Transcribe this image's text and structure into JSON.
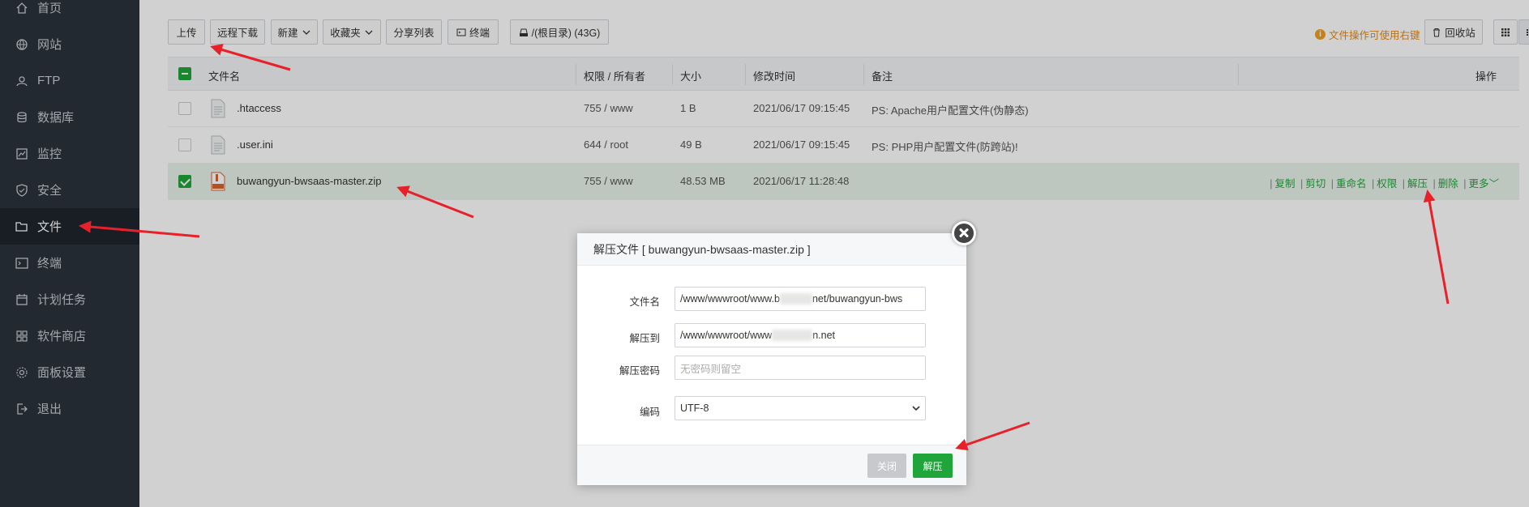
{
  "sidebar": {
    "items": [
      {
        "label": "首页",
        "icon": "home-icon"
      },
      {
        "label": "网站",
        "icon": "globe-icon"
      },
      {
        "label": "FTP",
        "icon": "ftp-icon"
      },
      {
        "label": "数据库",
        "icon": "database-icon"
      },
      {
        "label": "监控",
        "icon": "monitor-icon"
      },
      {
        "label": "安全",
        "icon": "shield-icon"
      },
      {
        "label": "文件",
        "icon": "folder-icon",
        "active": true
      },
      {
        "label": "终端",
        "icon": "terminal-icon"
      },
      {
        "label": "计划任务",
        "icon": "calendar-icon"
      },
      {
        "label": "软件商店",
        "icon": "apps-icon"
      },
      {
        "label": "面板设置",
        "icon": "gear-icon"
      },
      {
        "label": "退出",
        "icon": "logout-icon"
      }
    ]
  },
  "toolbar": {
    "upload": "上传",
    "remote_download": "远程下载",
    "new": "新建",
    "favorites": "收藏夹",
    "share_list": "分享列表",
    "terminal": "终端",
    "path": "/(根目录) (43G)",
    "tip": "文件操作可使用右键",
    "recycle": "回收站"
  },
  "table": {
    "headers": {
      "name": "文件名",
      "perm": "权限 / 所有者",
      "size": "大小",
      "mtime": "修改时间",
      "remark": "备注",
      "ops": "操作"
    },
    "rows": [
      {
        "name": ".htaccess",
        "perm": "755 / www",
        "size": "1 B",
        "mtime": "2021/06/17 09:15:45",
        "remark": "PS: Apache用户配置文件(伪静态)"
      },
      {
        "name": ".user.ini",
        "perm": "644 / root",
        "size": "49 B",
        "mtime": "2021/06/17 09:15:45",
        "remark": "PS: PHP用户配置文件(防跨站)!"
      },
      {
        "name": "buwangyun-bwsaas-master.zip",
        "perm": "755 / www",
        "size": "48.53 MB",
        "mtime": "2021/06/17 11:28:48",
        "remark": ""
      }
    ],
    "row_ops": {
      "copy": "复制",
      "cut": "剪切",
      "rename": "重命名",
      "perm": "权限",
      "unzip": "解压",
      "delete": "删除",
      "more": "更多"
    }
  },
  "dialog": {
    "title": "解压文件 [ buwangyun-bwsaas-master.zip ]",
    "filename_label": "文件名",
    "filename_pre": "/www/wwwroot/www.b",
    "filename_post": "net/buwangyun-bws",
    "dest_label": "解压到",
    "dest_pre": "/www/wwwroot/www",
    "dest_post": "n.net",
    "password_label": "解压密码",
    "password_placeholder": "无密码则留空",
    "encoding_label": "编码",
    "encoding_value": "UTF-8",
    "close_btn": "关闭",
    "unzip_btn": "解压"
  },
  "colors": {
    "sidebar_bg": "#2b323b",
    "accent": "#20a53a",
    "arrow": "#e8202a"
  }
}
